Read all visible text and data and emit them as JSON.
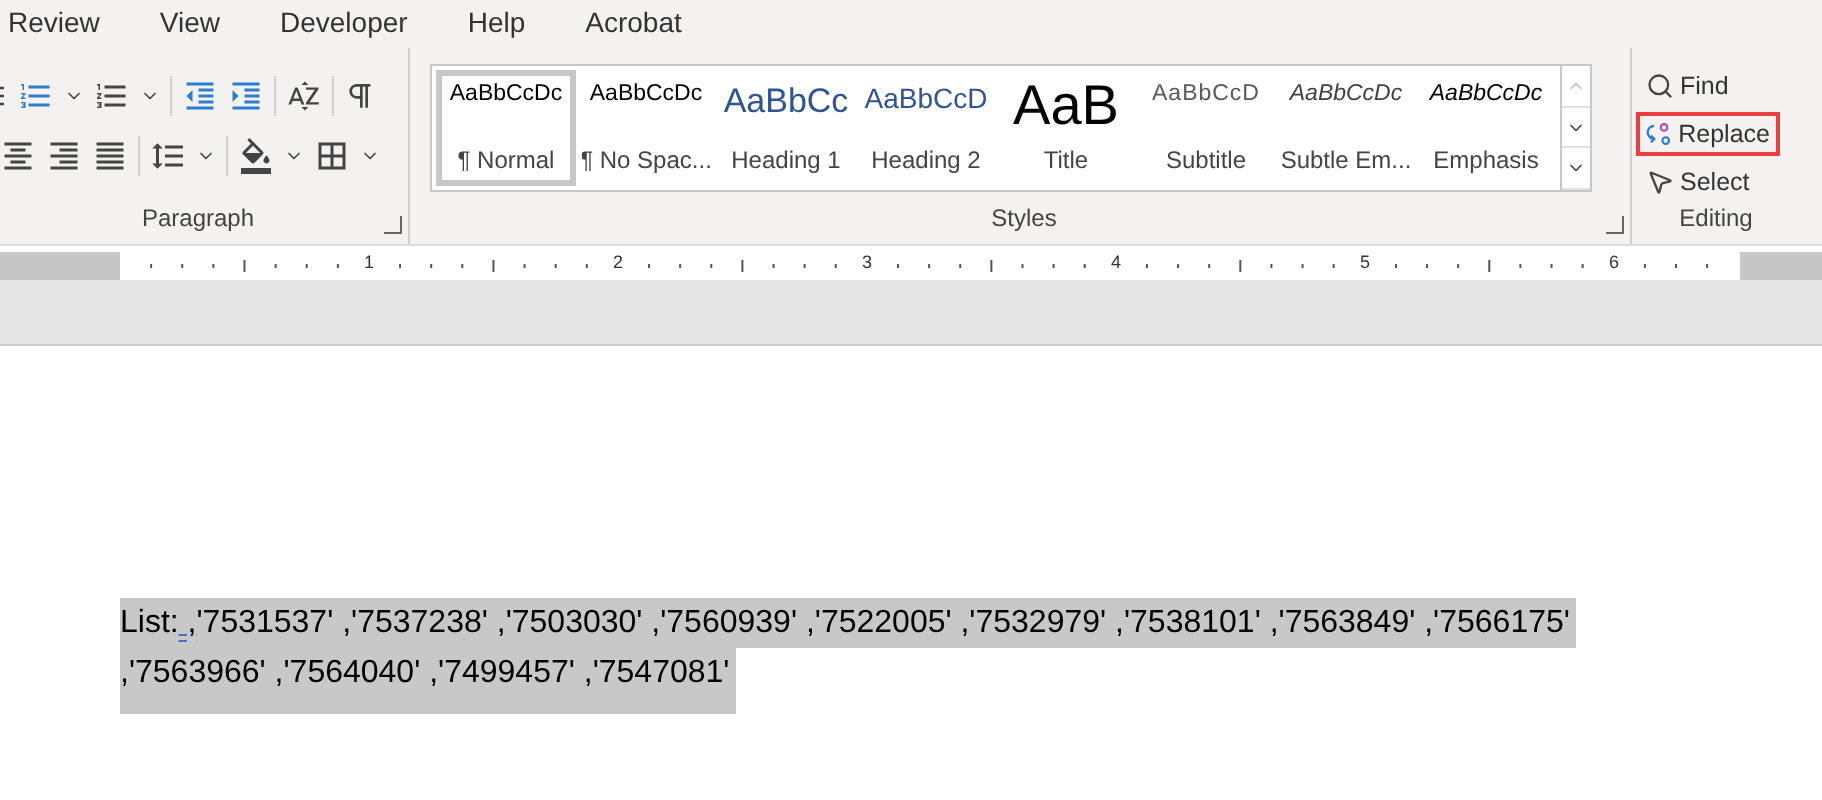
{
  "menu_tabs": [
    {
      "label": "Review",
      "selected": false
    },
    {
      "label": "View",
      "selected": false
    },
    {
      "label": "Developer",
      "selected": false
    },
    {
      "label": "Help",
      "selected": false
    },
    {
      "label": "Acrobat",
      "selected": false
    }
  ],
  "paragraph_group": {
    "label": "Paragraph"
  },
  "styles_group": {
    "label": "Styles",
    "styles": [
      {
        "preview": "AaBbCcDc",
        "label": "¶ Normal",
        "kind": "normal",
        "selected": true
      },
      {
        "preview": "AaBbCcDc",
        "label": "¶ No Spac...",
        "kind": "normal",
        "selected": false
      },
      {
        "preview": "AaBbCc",
        "label": "Heading 1",
        "kind": "heading1",
        "selected": false
      },
      {
        "preview": "AaBbCcD",
        "label": "Heading 2",
        "kind": "heading2",
        "selected": false
      },
      {
        "preview": "AaB",
        "label": "Title",
        "kind": "title",
        "selected": false
      },
      {
        "preview": "AaBbCcD",
        "label": "Subtitle",
        "kind": "subtitle",
        "selected": false
      },
      {
        "preview": "AaBbCcDc",
        "label": "Subtle Em...",
        "kind": "subtle",
        "selected": false
      },
      {
        "preview": "AaBbCcDc",
        "label": "Emphasis",
        "kind": "emphasis",
        "selected": false
      }
    ]
  },
  "editing_group": {
    "label": "Editing",
    "commands": [
      {
        "kind": "find",
        "label": "Find",
        "highlighted": false
      },
      {
        "kind": "replace",
        "label": "Replace",
        "highlighted": true
      },
      {
        "kind": "select",
        "label": "Select",
        "highlighted": false
      }
    ]
  },
  "ruler": {
    "numbers": [
      "1",
      "2",
      "3",
      "4",
      "5",
      "6"
    ]
  },
  "document": {
    "selected": true,
    "lines": [
      {
        "segments": [
          {
            "text": "List:",
            "flagged": false
          },
          {
            "text": " ,",
            "flagged": true
          },
          {
            "text": "'7531537' ,'7537238' ,'7503030' ,'7560939' ,'7522005' ,'7532979' ,'7538101' ,'7563849' ,'7566175'",
            "flagged": false
          }
        ]
      },
      {
        "segments": [
          {
            "text": ",'7563966' ,'7564040' ,'7499457' ,'7547081'",
            "flagged": false
          }
        ]
      }
    ]
  }
}
